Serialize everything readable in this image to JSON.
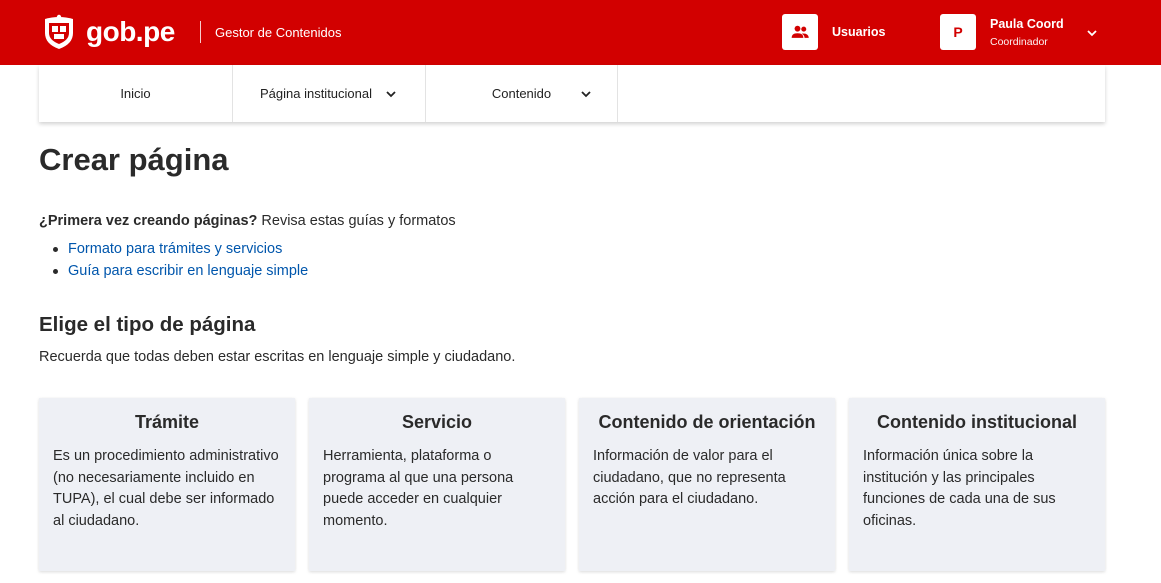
{
  "header": {
    "brand": "gob.pe",
    "app_name": "Gestor de Contenidos",
    "users_label": "Usuarios",
    "user": {
      "initial": "P",
      "name": "Paula Coord",
      "role": "Coordinador"
    }
  },
  "nav": {
    "items": [
      {
        "label": "Inicio"
      },
      {
        "label": "Página institucional"
      },
      {
        "label": "Contenido"
      }
    ]
  },
  "main": {
    "title": "Crear página",
    "intro_bold": "¿Primera vez creando páginas?",
    "intro_rest": " Revisa estas guías y formatos",
    "links": [
      {
        "label": "Formato para trámites y servicios"
      },
      {
        "label": "Guía para escribir en lenguaje simple"
      }
    ],
    "section_title": "Elige el tipo de página",
    "section_sub": "Recuerda que todas deben estar escritas en lenguaje simple y ciudadano.",
    "cards": [
      {
        "title": "Trámite",
        "description": "Es un procedimiento administrativo (no necesariamente incluido en TUPA), el cual debe ser informado al ciudadano."
      },
      {
        "title": "Servicio",
        "description": "Herramienta, plataforma o programa al que una persona puede acceder en cualquier momento."
      },
      {
        "title": "Contenido de orientación",
        "description": "Información de valor para el ciudadano, que no representa acción para el ciudadano."
      },
      {
        "title": "Contenido institucional",
        "description": "Información única sobre la institución y las principales funciones de cada una de sus oficinas."
      }
    ]
  },
  "colors": {
    "brand_red": "#d20000",
    "link_blue": "#0056ac",
    "card_bg": "#eef0f5"
  }
}
